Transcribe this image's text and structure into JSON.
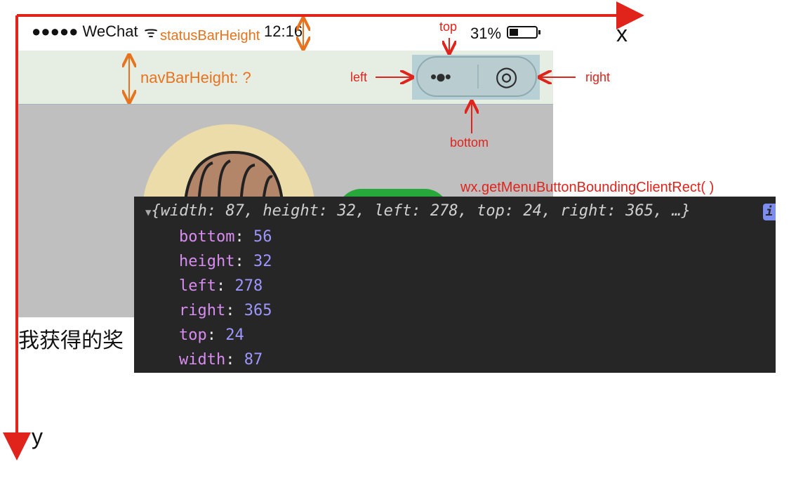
{
  "status_bar": {
    "carrier": "●●●●● WeChat",
    "time": "12:16",
    "battery": "31%"
  },
  "labels": {
    "status_bar_height": "statusBarHeight",
    "nav_bar_height": "navBarHeight: ?",
    "top": "top",
    "left": "left",
    "right": "right",
    "bottom": "bottom",
    "api": "wx.getMenuButtonBoundingClientRect( )",
    "axis_x": "x",
    "axis_y": "y"
  },
  "capsule": {
    "more": "•●•",
    "close": "◎"
  },
  "footer_text": "我获得的奖",
  "console": {
    "summary": {
      "prefix": "{",
      "width_key": "width",
      "width_val": "87",
      "height_key": "height",
      "height_val": "32",
      "left_key": "left",
      "left_val": "278",
      "top_key": "top",
      "top_val": "24",
      "right_key": "right",
      "right_val": "365",
      "suffix": ", …}",
      "info": "i"
    },
    "props": [
      {
        "key": "bottom",
        "value": "56"
      },
      {
        "key": "height",
        "value": "32"
      },
      {
        "key": "left",
        "value": "278"
      },
      {
        "key": "right",
        "value": "365"
      },
      {
        "key": "top",
        "value": "24"
      },
      {
        "key": "width",
        "value": "87"
      }
    ]
  },
  "colors": {
    "axis": "#e0241c",
    "annotation": "#e8731e",
    "console_bg": "#262626"
  }
}
